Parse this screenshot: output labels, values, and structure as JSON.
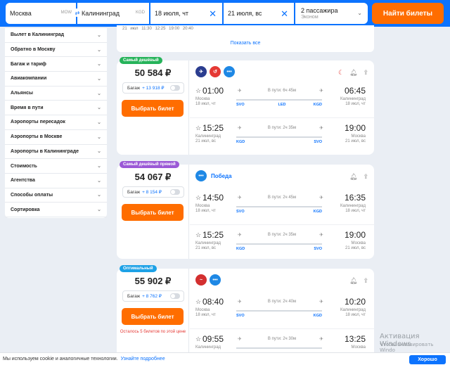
{
  "search": {
    "from": "Москва",
    "from_code": "MOW",
    "to": "Калининград",
    "to_code": "KGD",
    "date_out": "18 июля, чт",
    "date_back": "21 июля, вс",
    "passengers": "2 пассажира",
    "class": "Эконом",
    "find_button": "Найти билеты"
  },
  "filters": [
    "Вылет в Калининград",
    "Обратно в Москву",
    "Багаж и тариф",
    "Авиакомпании",
    "Альянсы",
    "Время в пути",
    "Аэропорты пересадок",
    "Аэропорты в Москве",
    "Аэропорты в Калининграде",
    "Стоимость",
    "Агентства",
    "Способы оплаты",
    "Сортировка"
  ],
  "top_card": {
    "row": "21 июл  11:30  12:25  19:00  20:40",
    "show_all": "Показать все"
  },
  "cards": [
    {
      "badge": "Самый дешёвый",
      "badge_color": "#26b35a",
      "price": "50 584 ₽",
      "bag_label": "Багаж",
      "bag_price": "+ 13 918 ₽",
      "buy": "Выбрать билет",
      "note": "",
      "airline": "",
      "segments": [
        {
          "dep_time": "01:00",
          "arr_time": "06:45",
          "dep_city": "Москва",
          "dep_date": "18 июл, чт",
          "arr_city": "Калининград",
          "arr_date": "18 июл, чт",
          "duration": "В пути: 6ч 45м",
          "c1": "SVO",
          "cm": "LED",
          "c2": "KGD"
        },
        {
          "dep_time": "15:25",
          "arr_time": "19:00",
          "dep_city": "Калининград",
          "dep_date": "21 июл, вс",
          "arr_city": "Москва",
          "arr_date": "21 июл, вс",
          "duration": "В пути: 2ч 35м",
          "c1": "KGD",
          "cm": "",
          "c2": "SVO"
        }
      ]
    },
    {
      "badge": "Самый дешёвый прямой",
      "badge_color": "#9b59d6",
      "price": "54 067 ₽",
      "bag_label": "Багаж",
      "bag_price": "+ 8 154 ₽",
      "buy": "Выбрать билет",
      "note": "",
      "airline": "Победа",
      "segments": [
        {
          "dep_time": "14:50",
          "arr_time": "16:35",
          "dep_city": "Москва",
          "dep_date": "18 июл, чт",
          "arr_city": "Калининград",
          "arr_date": "18 июл, чт",
          "duration": "В пути: 2ч 45м",
          "c1": "SVO",
          "cm": "",
          "c2": "KGD"
        },
        {
          "dep_time": "15:25",
          "arr_time": "19:00",
          "dep_city": "Калининград",
          "dep_date": "21 июл, вс",
          "arr_city": "Москва",
          "arr_date": "21 июл, вс",
          "duration": "В пути: 2ч 35м",
          "c1": "KGD",
          "cm": "",
          "c2": "SVO"
        }
      ]
    },
    {
      "badge": "Оптимальный",
      "badge_color": "#1da1e6",
      "price": "55 902 ₽",
      "bag_label": "Багаж",
      "bag_price": "+ 8 762 ₽",
      "buy": "Выбрать билет",
      "note": "Осталось 5 билетов по этой цене",
      "airline": "",
      "segments": [
        {
          "dep_time": "08:40",
          "arr_time": "10:20",
          "dep_city": "Москва",
          "dep_date": "18 июл, чт",
          "arr_city": "Калининград",
          "arr_date": "18 июл, чт",
          "duration": "В пути: 2ч 40м",
          "c1": "SVO",
          "cm": "",
          "c2": "KGD"
        },
        {
          "dep_time": "09:55",
          "arr_time": "13:25",
          "dep_city": "Калининград",
          "dep_date": "",
          "arr_city": "Москва",
          "arr_date": "",
          "duration": "В пути: 2ч 30м",
          "c1": "",
          "cm": "",
          "c2": ""
        }
      ]
    }
  ],
  "cookie": {
    "text": "Мы используем cookie и аналогичные технологии.",
    "link": "Узнайте подробнее",
    "ok": "Хорошо"
  },
  "watermark": {
    "line1": "Активация Windows",
    "line2": "Чтобы активировать Windo"
  }
}
